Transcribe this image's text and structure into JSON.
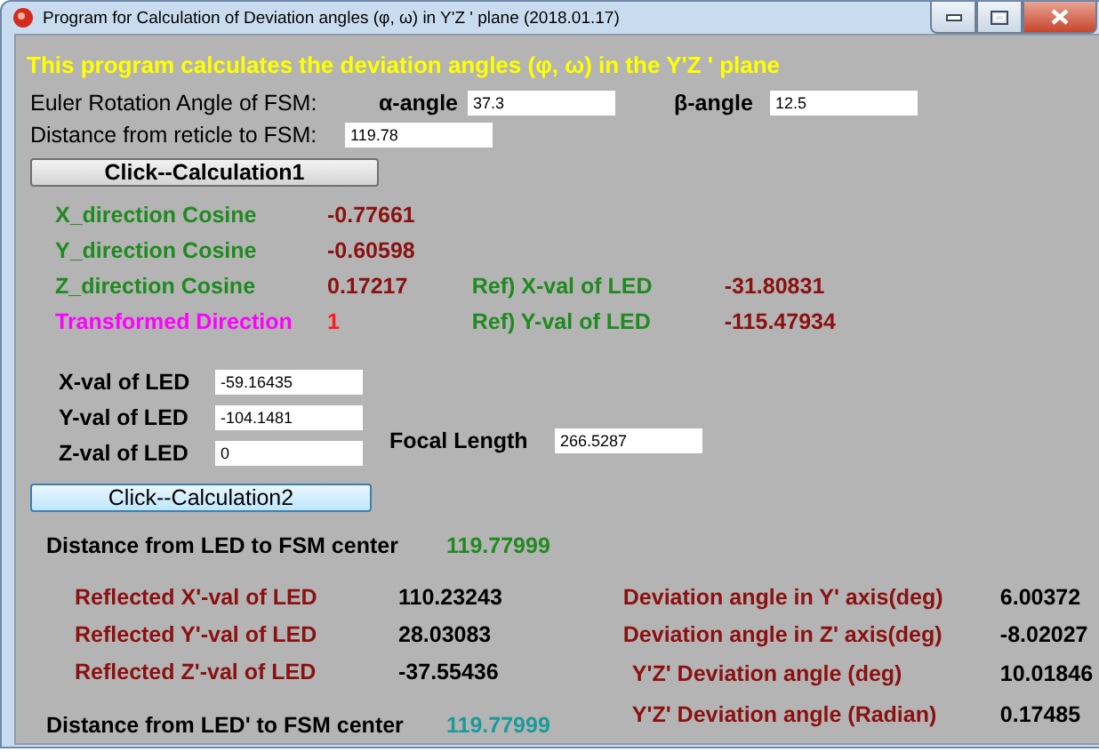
{
  "window": {
    "title": "Program for Calculation of Deviation angles (φ, ω) in  Y'Z ' plane (2018.01.17)"
  },
  "heading": "This program calculates the deviation angles (φ, ω) in the Y'Z ' plane",
  "euler": {
    "label": "Euler Rotation Angle of FSM:",
    "alpha": {
      "label": "α-angle",
      "value": "37.3"
    },
    "beta": {
      "label": "β-angle",
      "value": "12.5"
    }
  },
  "reticle_distance": {
    "label": "Distance from reticle to FSM:",
    "value": "119.78"
  },
  "calc1_button": "Click--Calculation1",
  "cosines": [
    {
      "label": "X_direction Cosine",
      "value": "-0.77661"
    },
    {
      "label": "Y_direction Cosine",
      "value": "-0.60598"
    },
    {
      "label": "Z_direction Cosine",
      "value": "0.17217"
    }
  ],
  "transformed_direction": {
    "label": "Transformed Direction",
    "value": "1"
  },
  "ref_values": [
    {
      "label": "Ref) X-val of LED",
      "value": "-31.80831"
    },
    {
      "label": "Ref) Y-val of LED",
      "value": "-115.47934"
    }
  ],
  "led_inputs": [
    {
      "label": "X-val of LED",
      "value": "-59.16435"
    },
    {
      "label": "Y-val of LED",
      "value": "-104.1481"
    },
    {
      "label": "Z-val of LED",
      "value": "0"
    }
  ],
  "focal_length": {
    "label": "Focal Length",
    "value": "266.5287"
  },
  "calc2_button": "Click--Calculation2",
  "led_distance": {
    "label": "Distance from LED to FSM center",
    "value": "119.77999"
  },
  "reflected": [
    {
      "label": "Reflected X'-val of LED",
      "value": "110.23243"
    },
    {
      "label": "Reflected Y'-val of LED",
      "value": "28.03083"
    },
    {
      "label": "Reflected Z'-val of LED",
      "value": "-37.55436"
    }
  ],
  "deviations": [
    {
      "label": "Deviation angle in Y' axis(deg)",
      "value": "6.00372"
    },
    {
      "label": "Deviation angle in Z' axis(deg)",
      "value": "-8.02027"
    },
    {
      "label": "Y'Z' Deviation angle (deg)",
      "value": "10.01846"
    },
    {
      "label": "Y'Z' Deviation angle (Radian)",
      "value": "0.17485"
    }
  ],
  "reflected_distance": {
    "label": "Distance from LED' to FSM center",
    "value": "119.77999"
  }
}
